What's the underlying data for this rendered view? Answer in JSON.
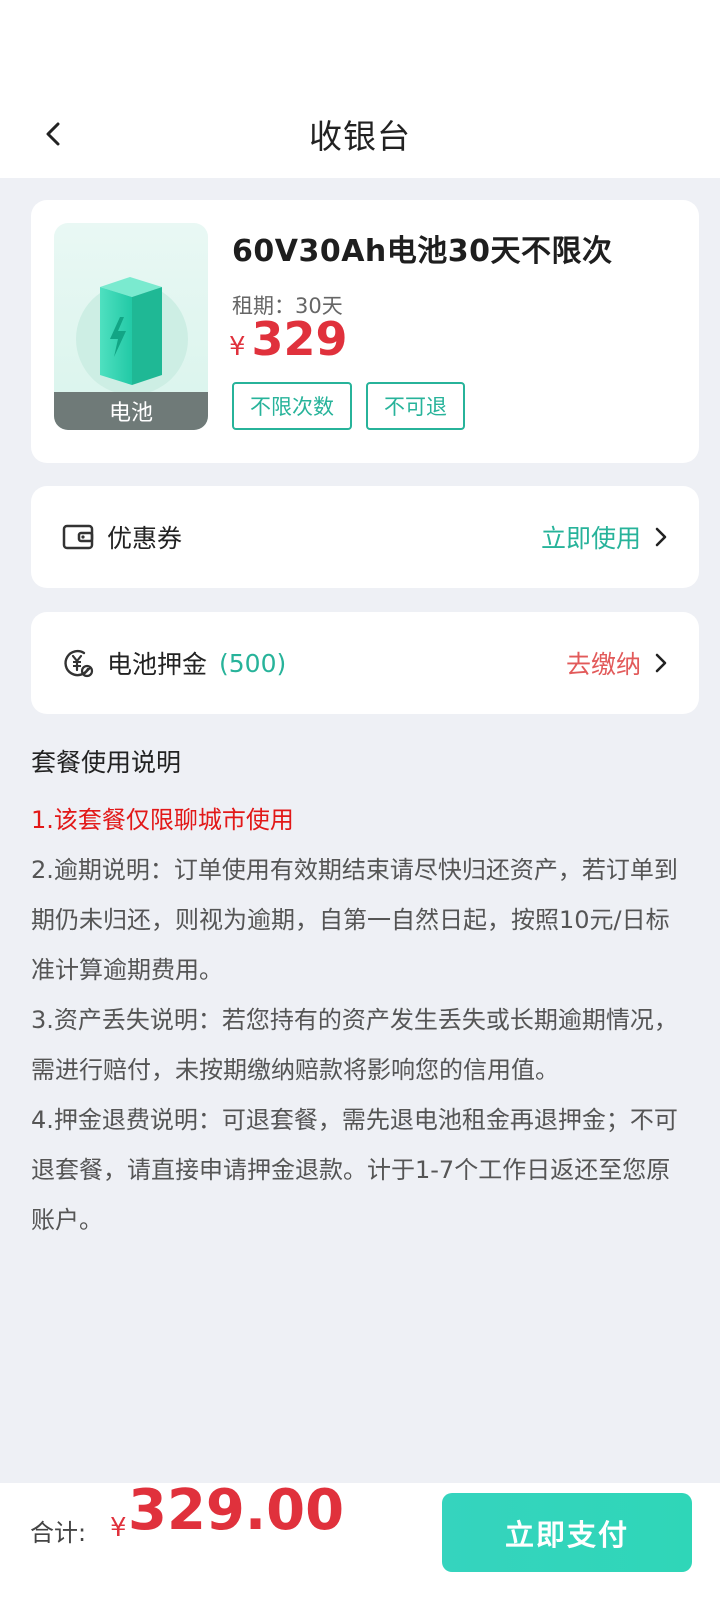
{
  "header": {
    "title": "收银台"
  },
  "product": {
    "thumb_label": "电池",
    "title": "60V30Ah电池30天不限次",
    "period": "租期：30天",
    "price_symbol": "¥",
    "price": "329",
    "tags": [
      "不限次数",
      "不可退"
    ]
  },
  "coupon": {
    "label": "优惠券",
    "action": "立即使用"
  },
  "deposit": {
    "label": "电池押金",
    "amount": "(500)",
    "action": "去缴纳"
  },
  "description": {
    "title": "套餐使用说明",
    "items": [
      "1.该套餐仅限聊城市使用",
      "2.逾期说明：订单使用有效期结束请尽快归还资产，若订单到期仍未归还，则视为逾期，自第一自然日起，按照10元/日标准计算逾期费用。",
      "3.资产丢失说明：若您持有的资产发生丢失或长期逾期情况，需进行赔付，未按期缴纳赔款将影响您的信用值。",
      "4.押金退费说明：可退套餐，需先退电池租金再退押金；不可退套餐，请直接申请押金退款。计于1-7个工作日返还至您原账户。"
    ]
  },
  "footer": {
    "total_label": "合计:",
    "total_symbol": "¥",
    "total": "329.00",
    "pay_label": "立即支付"
  },
  "colors": {
    "accent": "#27b39a",
    "price": "#e0313c",
    "warning": "#e25a5a",
    "notice": "#e21818"
  }
}
